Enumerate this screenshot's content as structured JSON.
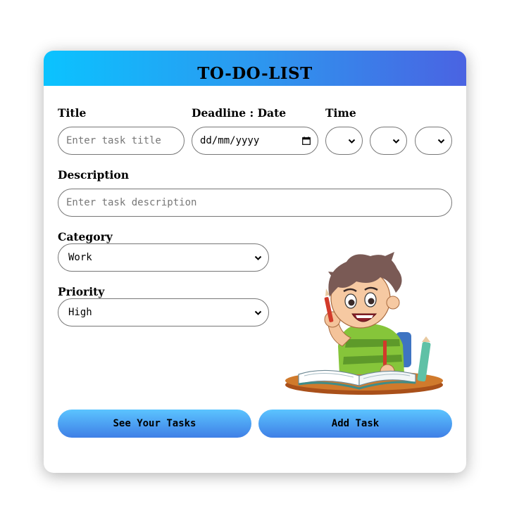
{
  "header": {
    "title": "TO-DO-LIST"
  },
  "form": {
    "title_label": "Title",
    "title_placeholder": "Enter task title",
    "deadline_label": "Deadline : Date",
    "date_value": "dd/mm/yyyy",
    "time_label": "Time",
    "description_label": "Description",
    "description_placeholder": "Enter task description",
    "category_label": "Category",
    "category_value": "Work",
    "priority_label": "Priority",
    "priority_value": "High"
  },
  "buttons": {
    "see_tasks": "See Your Tasks",
    "add_task": "Add Task"
  },
  "colors": {
    "header_gradient_start": "#0bc3ff",
    "header_gradient_end": "#4a63e2",
    "button_gradient_start": "#5bc4ff",
    "button_gradient_end": "#3f7fe6"
  }
}
